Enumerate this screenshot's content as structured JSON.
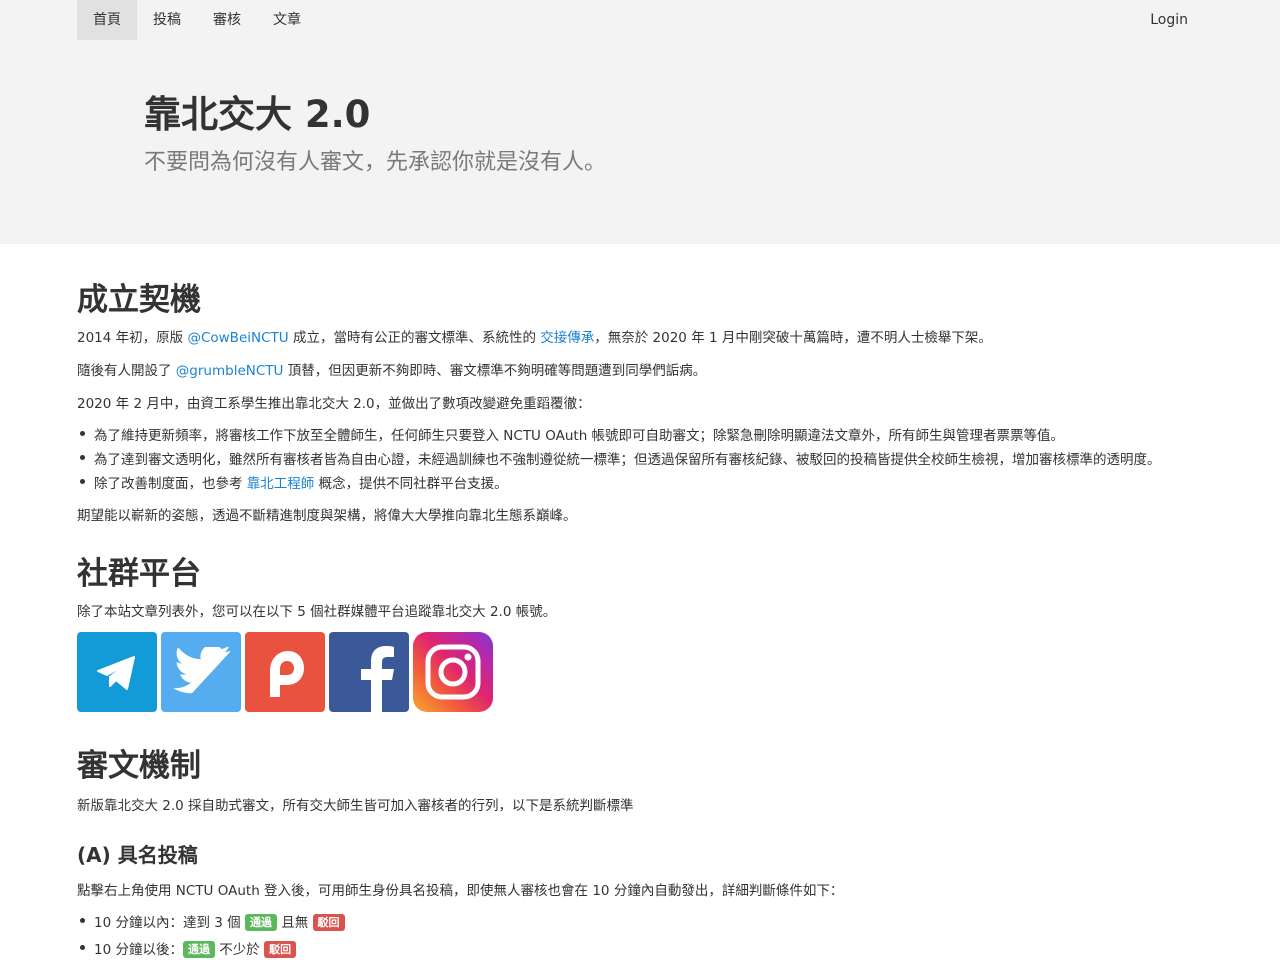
{
  "nav": {
    "items": [
      "首頁",
      "投稿",
      "審核",
      "文章"
    ],
    "login": "Login"
  },
  "hero": {
    "title": "靠北交大 2.0",
    "subtitle": "不要問為何沒有人審文，先承認你就是沒有人。"
  },
  "section1": {
    "heading": "成立契機",
    "p1": {
      "a": "2014 年初，原版 ",
      "link1": "@CowBeiNCTU",
      "b": " 成立，當時有公正的審文標準、系統性的 ",
      "link2": "交接傳承",
      "c": "，無奈於 2020 年 1 月中剛突破十萬篇時，遭不明人士檢舉下架。"
    },
    "p2": {
      "a": "隨後有人開設了 ",
      "link": "@grumbleNCTU",
      "b": " 頂替，但因更新不夠即時、審文標準不夠明確等問題遭到同學們詬病。"
    },
    "p3": "2020 年 2 月中，由資工系學生推出靠北交大 2.0，並做出了數項改變避免重蹈覆徹：",
    "li1": "為了維持更新頻率，將審核工作下放至全體師生，任何師生只要登入 NCTU OAuth 帳號即可自助審文；除緊急刪除明顯違法文章外，所有師生與管理者票票等值。",
    "li2": "為了達到審文透明化，雖然所有審核者皆為自由心證，未經過訓練也不強制遵從統一標準；但透過保留所有審核紀錄、被駁回的投稿皆提供全校師生檢視，增加審核標準的透明度。",
    "li3": {
      "a": "除了改善制度面，也參考 ",
      "link": "靠北工程師",
      "b": " 概念，提供不同社群平台支援。"
    },
    "p4": "期望能以嶄新的姿態，透過不斷精進制度與架構，將偉大大學推向靠北生態系巔峰。"
  },
  "section2": {
    "heading": "社群平台",
    "p1": "除了本站文章列表外，您可以在以下 5 個社群媒體平台追蹤靠北交大 2.0 帳號。",
    "icons": [
      {
        "name": "telegram-icon",
        "color": "#139bd8"
      },
      {
        "name": "twitter-icon",
        "color": "#55acee"
      },
      {
        "name": "plurk-icon",
        "color": "#e8523f"
      },
      {
        "name": "facebook-icon",
        "color": "#3b5998"
      },
      {
        "name": "instagram-icon",
        "color": "#d6249f"
      }
    ]
  },
  "section3": {
    "heading": "審文機制",
    "p1": "新版靠北交大 2.0 採自助式審文，所有交大師生皆可加入審核者的行列，以下是系統判斷標準",
    "subheading": "(A) 具名投稿",
    "p2": "點擊右上角使用 NCTU OAuth 登入後，可用師生身份具名投稿，即使無人審核也會在 10 分鐘內自動發出，詳細判斷條件如下：",
    "li1": {
      "a": "10 分鐘以內：達到 3 個 ",
      "ok": "通過",
      "b": " 且無 ",
      "no": "駁回"
    },
    "li2": {
      "a": "10 分鐘以後：",
      "ok": "通過",
      "b": " 不少於 ",
      "no": "駁回"
    }
  }
}
